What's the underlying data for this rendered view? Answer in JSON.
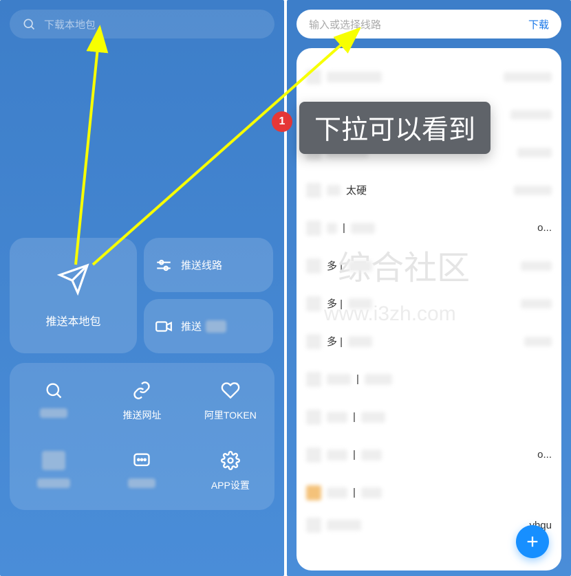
{
  "left": {
    "search_placeholder": "下载本地包",
    "big_card_label": "推送本地包",
    "small_card_1_label": "推送线路",
    "small_card_2_label": "推送",
    "grid": [
      {
        "label": "",
        "icon": "search-icon"
      },
      {
        "label": "推送网址",
        "icon": "link-icon"
      },
      {
        "label": "阿里TOKEN",
        "icon": "heart-icon"
      },
      {
        "label": "",
        "icon": "blur"
      },
      {
        "label": "",
        "icon": "chat-icon"
      },
      {
        "label": "APP设置",
        "icon": "gear-icon"
      }
    ]
  },
  "right": {
    "search_placeholder": "输入或选择线路",
    "download_label": "下载",
    "rows": [
      {
        "mid": "",
        "right": ""
      },
      {
        "mid": "",
        "right": ""
      },
      {
        "mid": "",
        "right": ""
      },
      {
        "mid": "太硬",
        "right": ""
      },
      {
        "mid": "|",
        "right": "o..."
      },
      {
        "mid": "多 | ",
        "right": ""
      },
      {
        "mid": "多 | ",
        "right": ""
      },
      {
        "mid": "多 | ",
        "right": ""
      },
      {
        "mid": "|",
        "right": ""
      },
      {
        "mid": "|",
        "right": ""
      },
      {
        "mid": "|",
        "right": "o..."
      },
      {
        "mid": "|",
        "right": ""
      },
      {
        "mid": "",
        "right": "yhqu"
      }
    ]
  },
  "annotation": {
    "badge_number": "1",
    "tooltip_text": "下拉可以看到"
  },
  "watermark": {
    "line1": "综合社区",
    "line2": "www.i3zh.com"
  }
}
